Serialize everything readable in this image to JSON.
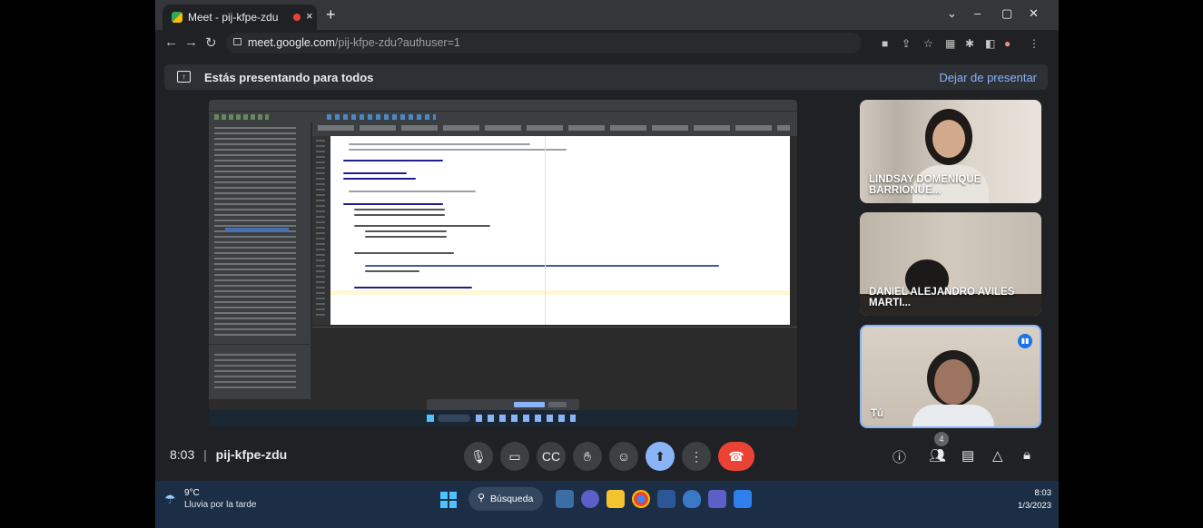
{
  "browser": {
    "tab_title": "Meet - pij-kfpe-zdu",
    "tab_close": "×",
    "new_tab": "+",
    "url_host": "meet.google.com",
    "url_path": "/pij-kfpe-zdu?authuser=1"
  },
  "banner": {
    "text": "Estás presentando para todos",
    "stop_label": "Dejar de presentar"
  },
  "participants": [
    {
      "name": "LINDSAY DOMENIQUE BARRIONUE..."
    },
    {
      "name": "DANIEL ALEJANDRO AVILES MARTI..."
    },
    {
      "name": "Tú"
    }
  ],
  "meeting": {
    "time": "8:03",
    "separator": "|",
    "code": "pij-kfpe-zdu",
    "participant_count": "4"
  },
  "taskbar": {
    "weather_temp": "9°C",
    "weather_cond": "Lluvia por la tarde",
    "search_label": "Búsqueda",
    "time": "8:03",
    "date": "1/3/2023"
  },
  "colors": {
    "accent": "#8ab4f8",
    "end_call": "#ea4335",
    "meet_bg": "#202124"
  }
}
